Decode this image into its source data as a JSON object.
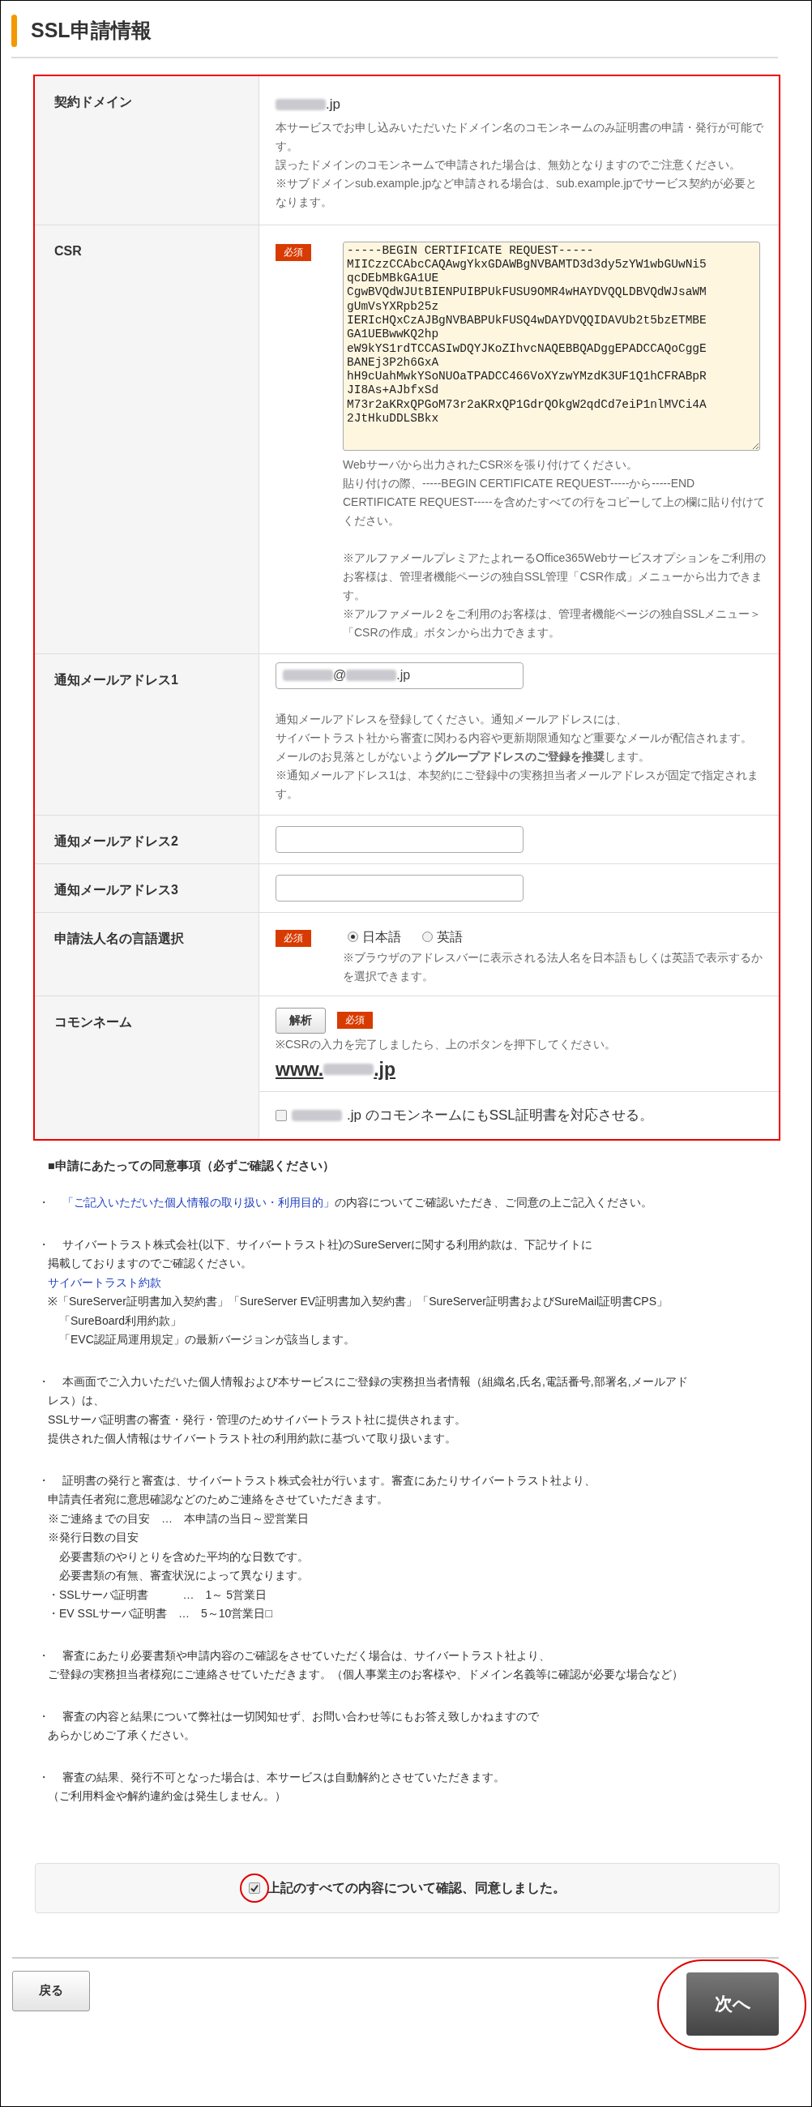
{
  "title": "SSL申請情報",
  "form_rows": [
    {
      "kind": "domain",
      "label": "契約ドメイン",
      "value_segments": [
        {
          "kind": "blurred"
        },
        {
          "kind": "text",
          "text": ".jp"
        }
      ],
      "notes": [
        "本サービスでお申し込みいただいたドメイン名のコモンネームのみ証明書の申請・発行が可能です。",
        "誤ったドメインのコモンネームで申請された場合は、無効となりますのでご注意ください。",
        "※サブドメインsub.example.jpなど申請される場合は、sub.example.jpでサービス契約が必要となります。"
      ]
    },
    {
      "kind": "csr",
      "label": "CSR",
      "badge": "必須",
      "value": "-----BEGIN CERTIFICATE REQUEST-----\nMIICzzCCAbcCAQAwgYkxGDAWBgNVBAMTD3d3dy5zYW1wbGUwNi5\nqcDEbMBkGA1UE\nCgwBVQdWJUtBIENPUIBPUkFUSU9OMR4wHAYDVQQLDBVQdWJsaWM\ngUmVsYXRpb25z\nIERIcHQxCzAJBgNVBABPUkFUSQ4wDAYDVQQIDAVUb2t5bzETMBE\nGA1UEBwwKQ2hp\neW9kYS1rdTCCASIwDQYJKoZIhvcNAQEBBQADggEPADCCAQoCggE\nBANEj3P2h6GxA\nhH9cUahMwkYSoNUOaTPADCC466VoXYzwYMzdK3UF1Q1hCFRABpR\nJI8As+AJbfxSd\nM73r2aKRxQPGoM73r2aKRxQP1GdrQOkgW2qdCd7eiP1nlMVCi4A\n2JtHkuDDLSBkx",
      "notes": [
        "Webサーバから出力されたCSR※を張り付けてください。",
        "貼り付けの際、-----BEGIN CERTIFICATE REQUEST-----から-----END CERTIFICATE REQUEST-----を含めたすべての行をコピーして上の欄に貼り付けてください。",
        "※アルファメールプレミアたよれーるOffice365Webサービスオプションをご利用のお客様は、管理者機能ページの独自SSL管理「CSR作成」メニューから出力できます。",
        "※アルファメール２をご利用のお客様は、管理者機能ページの独自SSLメニュー＞「CSRの作成」ボタンから出力できます。"
      ]
    },
    {
      "kind": "email",
      "label": "通知メールアドレス1",
      "value_segments": [
        {
          "kind": "blurred"
        },
        {
          "kind": "text",
          "text": "@"
        },
        {
          "kind": "blurred"
        },
        {
          "kind": "text",
          "text": ".jp"
        }
      ],
      "notes": [
        "通知メールアドレスを登録してください。通知メールアドレスには、",
        "サイバートラスト社から審査に関わる内容や更新期限通知など重要なメールが配信されます。",
        "メールのお見落としがないよう**グループアドレスのご登録を推奨**します。",
        "※通知メールアドレス1は、本契約にご登録中の実務担当者メールアドレスが固定で指定されます。"
      ]
    },
    {
      "kind": "email",
      "label": "通知メールアドレス2"
    },
    {
      "kind": "email",
      "label": "通知メールアドレス3"
    },
    {
      "kind": "language",
      "label": "申請法人名の言語選択",
      "badge": "必須",
      "options": [
        {
          "label": "日本語",
          "selected": true
        },
        {
          "label": "英語",
          "selected": false
        }
      ],
      "notes": [
        "※ブラウザのアドレスバーに表示される法人名を日本語もしくは英語で表示するかを選択できます。"
      ]
    },
    {
      "kind": "common_name",
      "label": "コモンネーム",
      "button": "解析",
      "badge": "必須",
      "notes": [
        "※CSRの入力を完了しましたら、上のボタンを押下してください。"
      ],
      "result_segments": [
        {
          "kind": "text",
          "text": "www."
        },
        {
          "kind": "blurred"
        },
        {
          "kind": "text",
          "text": ".jp"
        }
      ],
      "option": {
        "checked": false,
        "segments": [
          {
            "kind": "blurred"
          },
          {
            "kind": "text",
            "text": ".jp のコモンネームにもSSL証明書を対応させる。"
          }
        ]
      }
    }
  ],
  "agreement": {
    "heading": "■申請にあたっての同意事項（必ずご確認ください）",
    "items": [
      {
        "bullet": "・",
        "lines": [
          [
            {
              "text": "「ご記入いただいた個人情報の取り扱い・利用目的」",
              "link": true
            },
            {
              "text": "の内容についてご確認いただき、ご同意の上ご記入ください。",
              "link": false
            }
          ]
        ]
      },
      {
        "bullet": "・",
        "lines": [
          [
            {
              "text": "サイバートラスト株式会社(以下、サイバートラスト社)のSureServerに関する利用約款は、下記サイトに",
              "link": false
            }
          ],
          [
            {
              "text": "掲載しておりますのでご確認ください。",
              "link": false
            }
          ],
          [
            {
              "text": "サイバートラスト約款",
              "link": true
            }
          ],
          [
            {
              "text": "※「SureServer証明書加入契約書」「SureServer EV証明書加入契約書」「SureServer証明書およびSureMail証明書CPS」",
              "link": false
            }
          ],
          [
            {
              "text": "　「SureBoard利用約款」",
              "link": false
            }
          ],
          [
            {
              "text": "　「EVC認証局運用規定」の最新バージョンが該当します。",
              "link": false
            }
          ]
        ]
      },
      {
        "bullet": "・",
        "lines": [
          [
            {
              "text": "本画面でご入力いただいた個人情報および本サービスにご登録の実務担当者情報（組織名,氏名,電話番号,部署名,メールアド",
              "link": false
            }
          ],
          [
            {
              "text": "レス）は、",
              "link": false
            }
          ],
          [
            {
              "text": "SSLサーバ証明書の審査・発行・管理のためサイバートラスト社に提供されます。",
              "link": false
            }
          ],
          [
            {
              "text": "提供された個人情報はサイバートラスト社の利用約款に基づいて取り扱います。",
              "link": false
            }
          ]
        ]
      },
      {
        "bullet": "・",
        "lines": [
          [
            {
              "text": "証明書の発行と審査は、サイバートラスト株式会社が行います。審査にあたりサイバートラスト社より、",
              "link": false
            }
          ],
          [
            {
              "text": "申請責任者宛に意思確認などのためご連絡をさせていただきます。",
              "link": false
            }
          ],
          [
            {
              "text": "※ご連絡までの目安　…　本申請の当日～翌営業日",
              "link": false
            }
          ],
          [
            {
              "text": "※発行日数の目安",
              "link": false
            }
          ],
          [
            {
              "text": "　必要書類のやりとりを含めた平均的な日数です。",
              "link": false
            }
          ],
          [
            {
              "text": "　必要書類の有無、審査状況によって異なります。",
              "link": false
            }
          ],
          [
            {
              "text": "・SSLサーバ証明書　　　…　1～ 5営業日",
              "link": false
            }
          ],
          [
            {
              "text": "・EV SSLサーバ証明書　…　5～10営業日□",
              "link": false
            }
          ]
        ]
      },
      {
        "bullet": "・",
        "lines": [
          [
            {
              "text": "審査にあたり必要書類や申請内容のご確認をさせていただく場合は、サイバートラスト社より、",
              "link": false
            }
          ],
          [
            {
              "text": "ご登録の実務担当者様宛にご連絡させていただきます。（個人事業主のお客様や、ドメイン名義等に確認が必要な場合など）",
              "link": false
            }
          ]
        ]
      },
      {
        "bullet": "・",
        "lines": [
          [
            {
              "text": "審査の内容と結果について弊社は一切関知せず、お問い合わせ等にもお答え致しかねますので",
              "link": false
            }
          ],
          [
            {
              "text": "あらかじめご了承ください。",
              "link": false
            }
          ]
        ]
      },
      {
        "bullet": "・",
        "lines": [
          [
            {
              "text": "審査の結果、発行不可となった場合は、本サービスは自動解約とさせていただきます。",
              "link": false
            }
          ],
          [
            {
              "text": "（ご利用料金や解約違約金は発生しません。）",
              "link": false
            }
          ]
        ]
      }
    ]
  },
  "consent": {
    "label": "上記のすべての内容について確認、同意しました。",
    "checked": true
  },
  "buttons": {
    "back": "戻る",
    "next": "次へ"
  }
}
